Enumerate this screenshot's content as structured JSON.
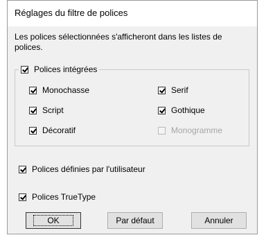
{
  "dialog": {
    "title": "Réglages du filtre de polices",
    "description": "Les polices sélectionnées s'afficheront dans les listes de polices."
  },
  "builtin_group": {
    "label": "Polices intégrées",
    "checked": true,
    "options": [
      {
        "label": "Monochasse",
        "checked": true,
        "enabled": true
      },
      {
        "label": "Serif",
        "checked": true,
        "enabled": true
      },
      {
        "label": "Script",
        "checked": true,
        "enabled": true
      },
      {
        "label": "Gothique",
        "checked": true,
        "enabled": true
      },
      {
        "label": "Décoratif",
        "checked": true,
        "enabled": true
      },
      {
        "label": "Monogramme",
        "checked": false,
        "enabled": false
      }
    ]
  },
  "user_defined": {
    "label": "Polices définies par l'utilisateur",
    "checked": true
  },
  "truetype": {
    "label": "Polices TrueType",
    "checked": true
  },
  "buttons": {
    "ok": "OK",
    "default": "Par défaut",
    "cancel": "Annuler"
  }
}
